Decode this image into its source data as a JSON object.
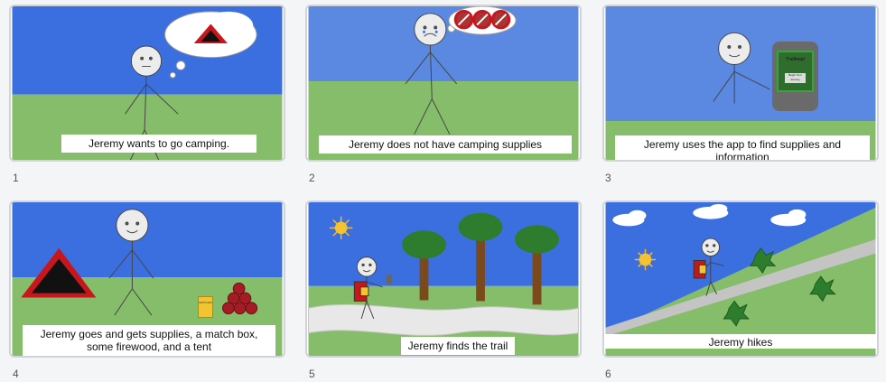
{
  "panels": [
    {
      "number": "1",
      "caption": "Jeremy wants to go camping."
    },
    {
      "number": "2",
      "caption": "Jeremy does not have camping supplies"
    },
    {
      "number": "3",
      "caption": "Jeremy uses the app to find supplies and information",
      "phone_title": "Trailhead",
      "phone_button": "Begin Your Journey"
    },
    {
      "number": "4",
      "caption": "Jeremy goes and gets supplies, a match box, some firewood, and a tent",
      "matchbox_label": "MATCHES"
    },
    {
      "number": "5",
      "caption": "Jeremy finds the trail"
    },
    {
      "number": "6",
      "caption": "Jeremy hikes"
    }
  ],
  "colors": {
    "sky": "#3b6fe0",
    "grass": "#86bd6a",
    "tent_red": "#c8161d",
    "border": "#d0d3d8"
  }
}
